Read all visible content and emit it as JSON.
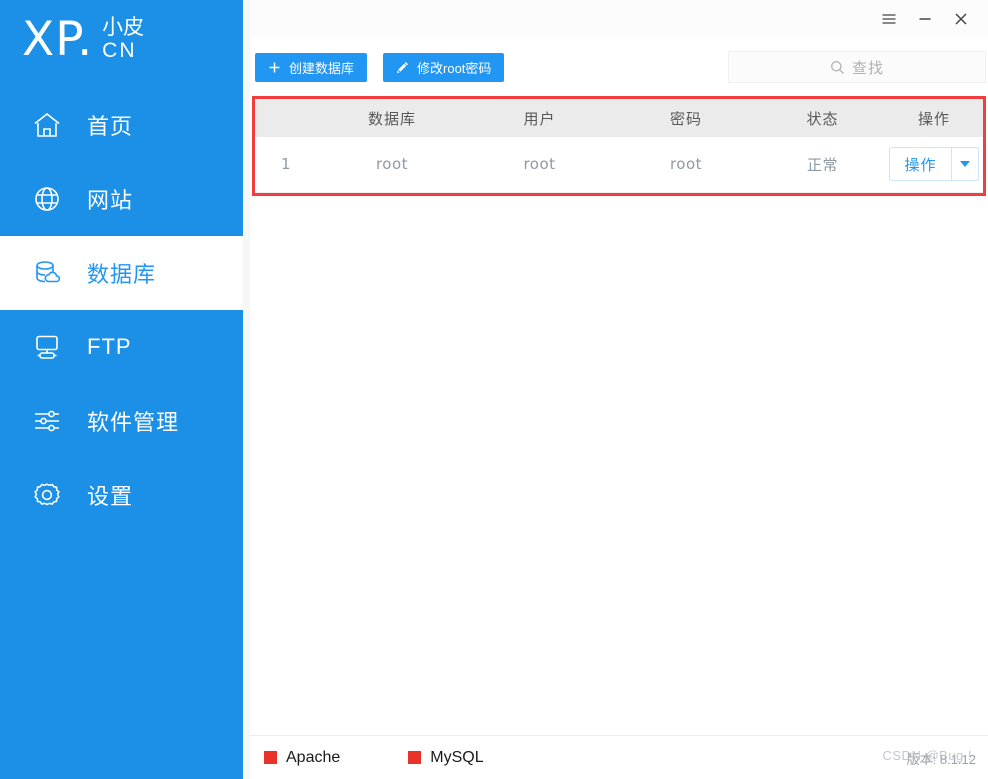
{
  "brand": {
    "logo_main": "XP.",
    "logo_cn_top": "小皮",
    "logo_cn_bottom": "CN"
  },
  "sidebar": {
    "background_color": "#1b90e6",
    "active_text_color": "#2196f3",
    "items": [
      {
        "label": "首页",
        "icon": "home-icon",
        "active": false
      },
      {
        "label": "网站",
        "icon": "globe-icon",
        "active": false
      },
      {
        "label": "数据库",
        "icon": "database-icon",
        "active": true
      },
      {
        "label": "FTP",
        "icon": "ftp-icon",
        "active": false
      },
      {
        "label": "软件管理",
        "icon": "sliders-icon",
        "active": false
      },
      {
        "label": "设置",
        "icon": "gear-icon",
        "active": false
      }
    ]
  },
  "titlebar": {
    "menu_icon": "hamburger-icon",
    "minimize_icon": "minimize-icon",
    "close_icon": "close-icon"
  },
  "toolbar": {
    "create_db_label": "创建数据库",
    "create_db_icon": "plus-icon",
    "edit_root_label": "修改root密码",
    "edit_root_icon": "pencil-icon",
    "button_color": "#2196f3"
  },
  "search": {
    "placeholder": "查找",
    "icon": "search-icon",
    "value": ""
  },
  "table": {
    "highlight_border_color": "#f03e3e",
    "header_background": "#ebebeb",
    "columns": [
      "",
      "数据库",
      "用户",
      "密码",
      "状态",
      "操作"
    ],
    "rows": [
      {
        "index": "1",
        "database": "root",
        "user": "root",
        "password": "root",
        "status": "正常",
        "action_label": "操作",
        "action_caret_icon": "chevron-down-icon"
      }
    ]
  },
  "statusbar": {
    "services": [
      {
        "name": "Apache",
        "indicator_color": "#e8322a"
      },
      {
        "name": "MySQL",
        "indicator_color": "#e8322a"
      }
    ],
    "version_text": "版本: 8.1.12",
    "watermark_text": "CSDN @Bug !"
  }
}
